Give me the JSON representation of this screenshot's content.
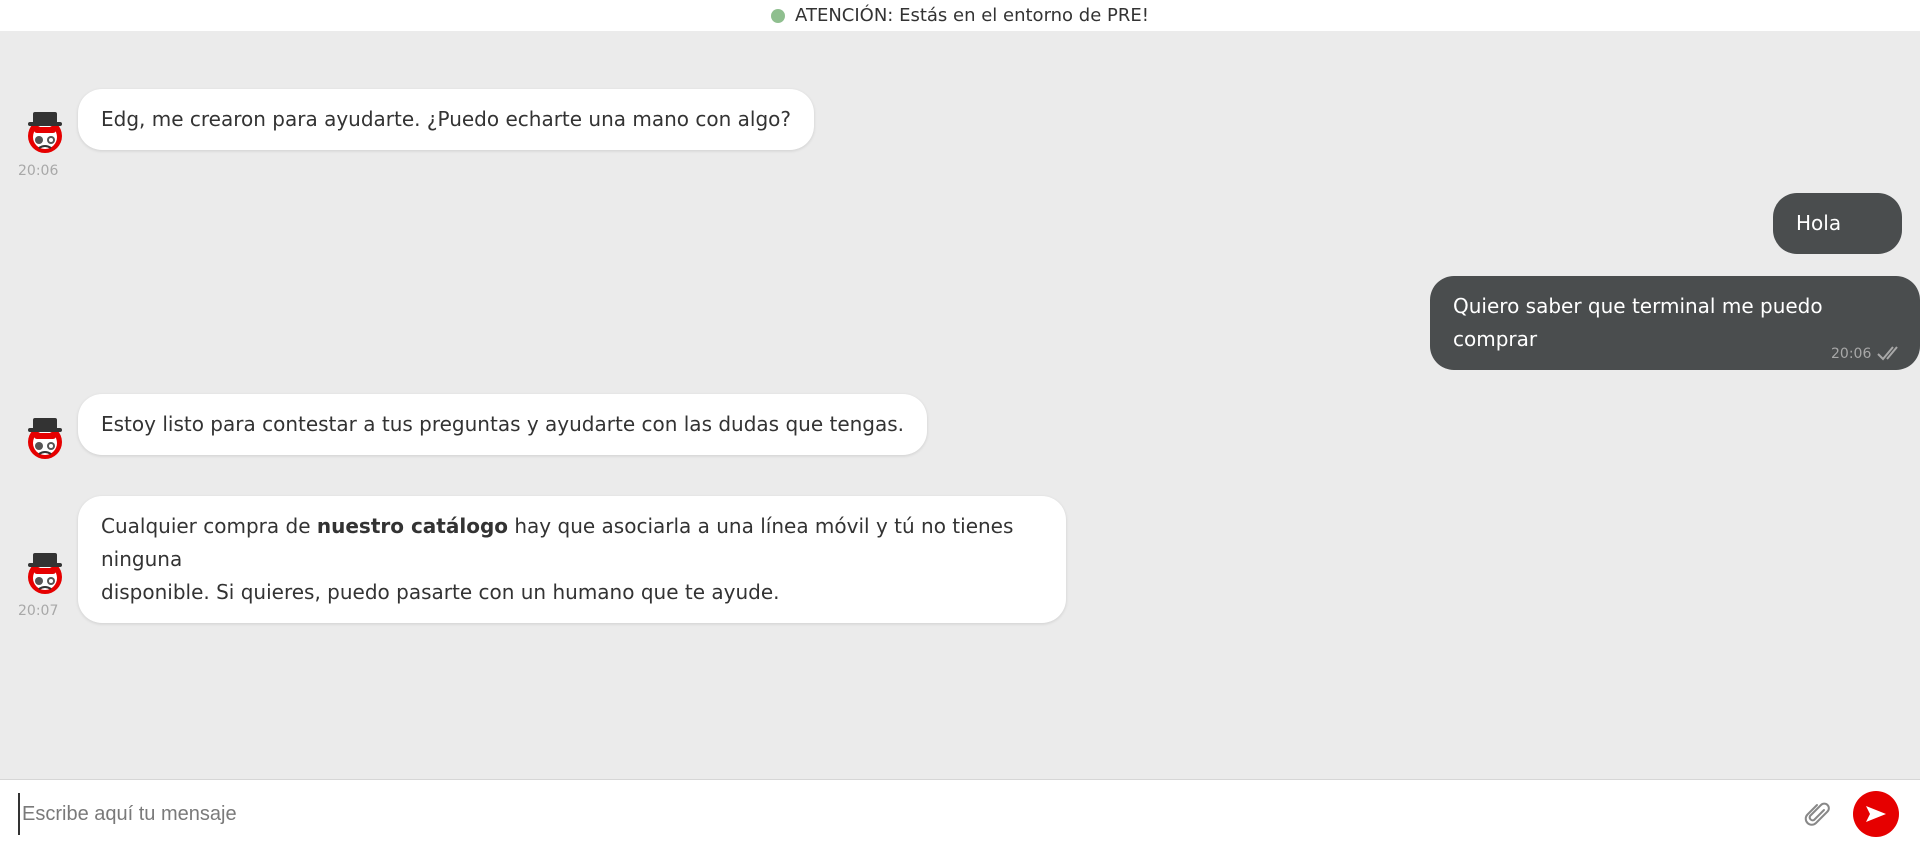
{
  "banner": {
    "text": "ATENCIÓN: Estás en el entorno de PRE!"
  },
  "messages": [
    {
      "sender": "bot",
      "text": "Edg, me crearon para ayudarte. ¿Puedo echarte una mano con algo?",
      "time": "20:06"
    },
    {
      "sender": "user",
      "text": "Hola"
    },
    {
      "sender": "user",
      "text": "Quiero saber que terminal me puedo comprar",
      "time": "20:06",
      "status": "read"
    },
    {
      "sender": "bot",
      "text": "Estoy listo para contestar a tus preguntas y ayudarte con las dudas que tengas."
    },
    {
      "sender": "bot",
      "text_before": "Cualquier compra de ",
      "text_bold": "nuestro catálogo",
      "text_after_line1": " hay que asociarla a una línea móvil y tú no tienes ninguna",
      "text_line2": "disponible. Si quieres, puedo pasarte con un humano que te ayude.",
      "time": "20:07"
    }
  ],
  "composer": {
    "placeholder": "Escribe aquí tu mensaje",
    "attach_icon": "paperclip-icon",
    "send_icon": "send-icon"
  },
  "colors": {
    "background": "#ebebeb",
    "bot_bubble": "#ffffff",
    "user_bubble": "#4a4d4e",
    "send_button": "#e60000",
    "status_dot": "#8fbf8f"
  }
}
